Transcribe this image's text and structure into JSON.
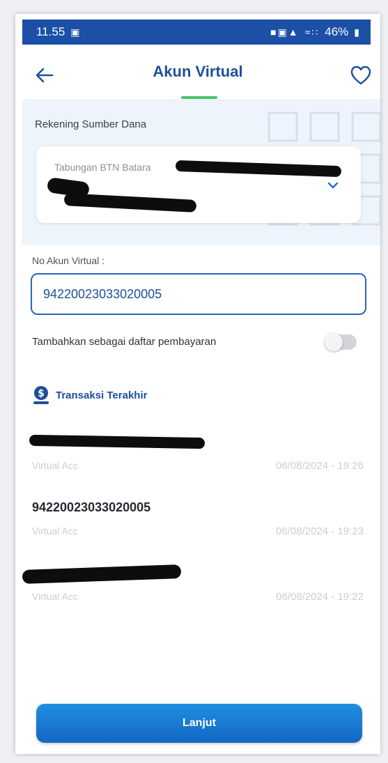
{
  "status_bar": {
    "time": "11.55",
    "battery": "46%"
  },
  "header": {
    "title": "Akun Virtual"
  },
  "source_account": {
    "label": "Rekening Sumber Dana",
    "account_name": "Tabungan BTN Batara"
  },
  "virtual_account": {
    "label": "No Akun Virtual :",
    "value": "94220023033020005"
  },
  "save_toggle": {
    "label": "Tambahkan sebagai daftar pembayaran",
    "enabled": false
  },
  "recent": {
    "title": "Transaksi Terakhir",
    "items": [
      {
        "number": "",
        "type": "Virtual Acc",
        "datetime": "06/08/2024 - 19:26",
        "redacted": true
      },
      {
        "number": "94220023033020005",
        "type": "Virtual Acc",
        "datetime": "06/08/2024 - 19:23",
        "redacted": false
      },
      {
        "number": "",
        "type": "Virtual Acc",
        "datetime": "06/08/2024 - 19:22",
        "redacted": true
      }
    ]
  },
  "footer": {
    "next_label": "Lanjut"
  },
  "colors": {
    "primary": "#1d4f9c",
    "status_bar": "#1c4fa6",
    "accent_green": "#4dc46a",
    "button": "#1a7ad6"
  }
}
